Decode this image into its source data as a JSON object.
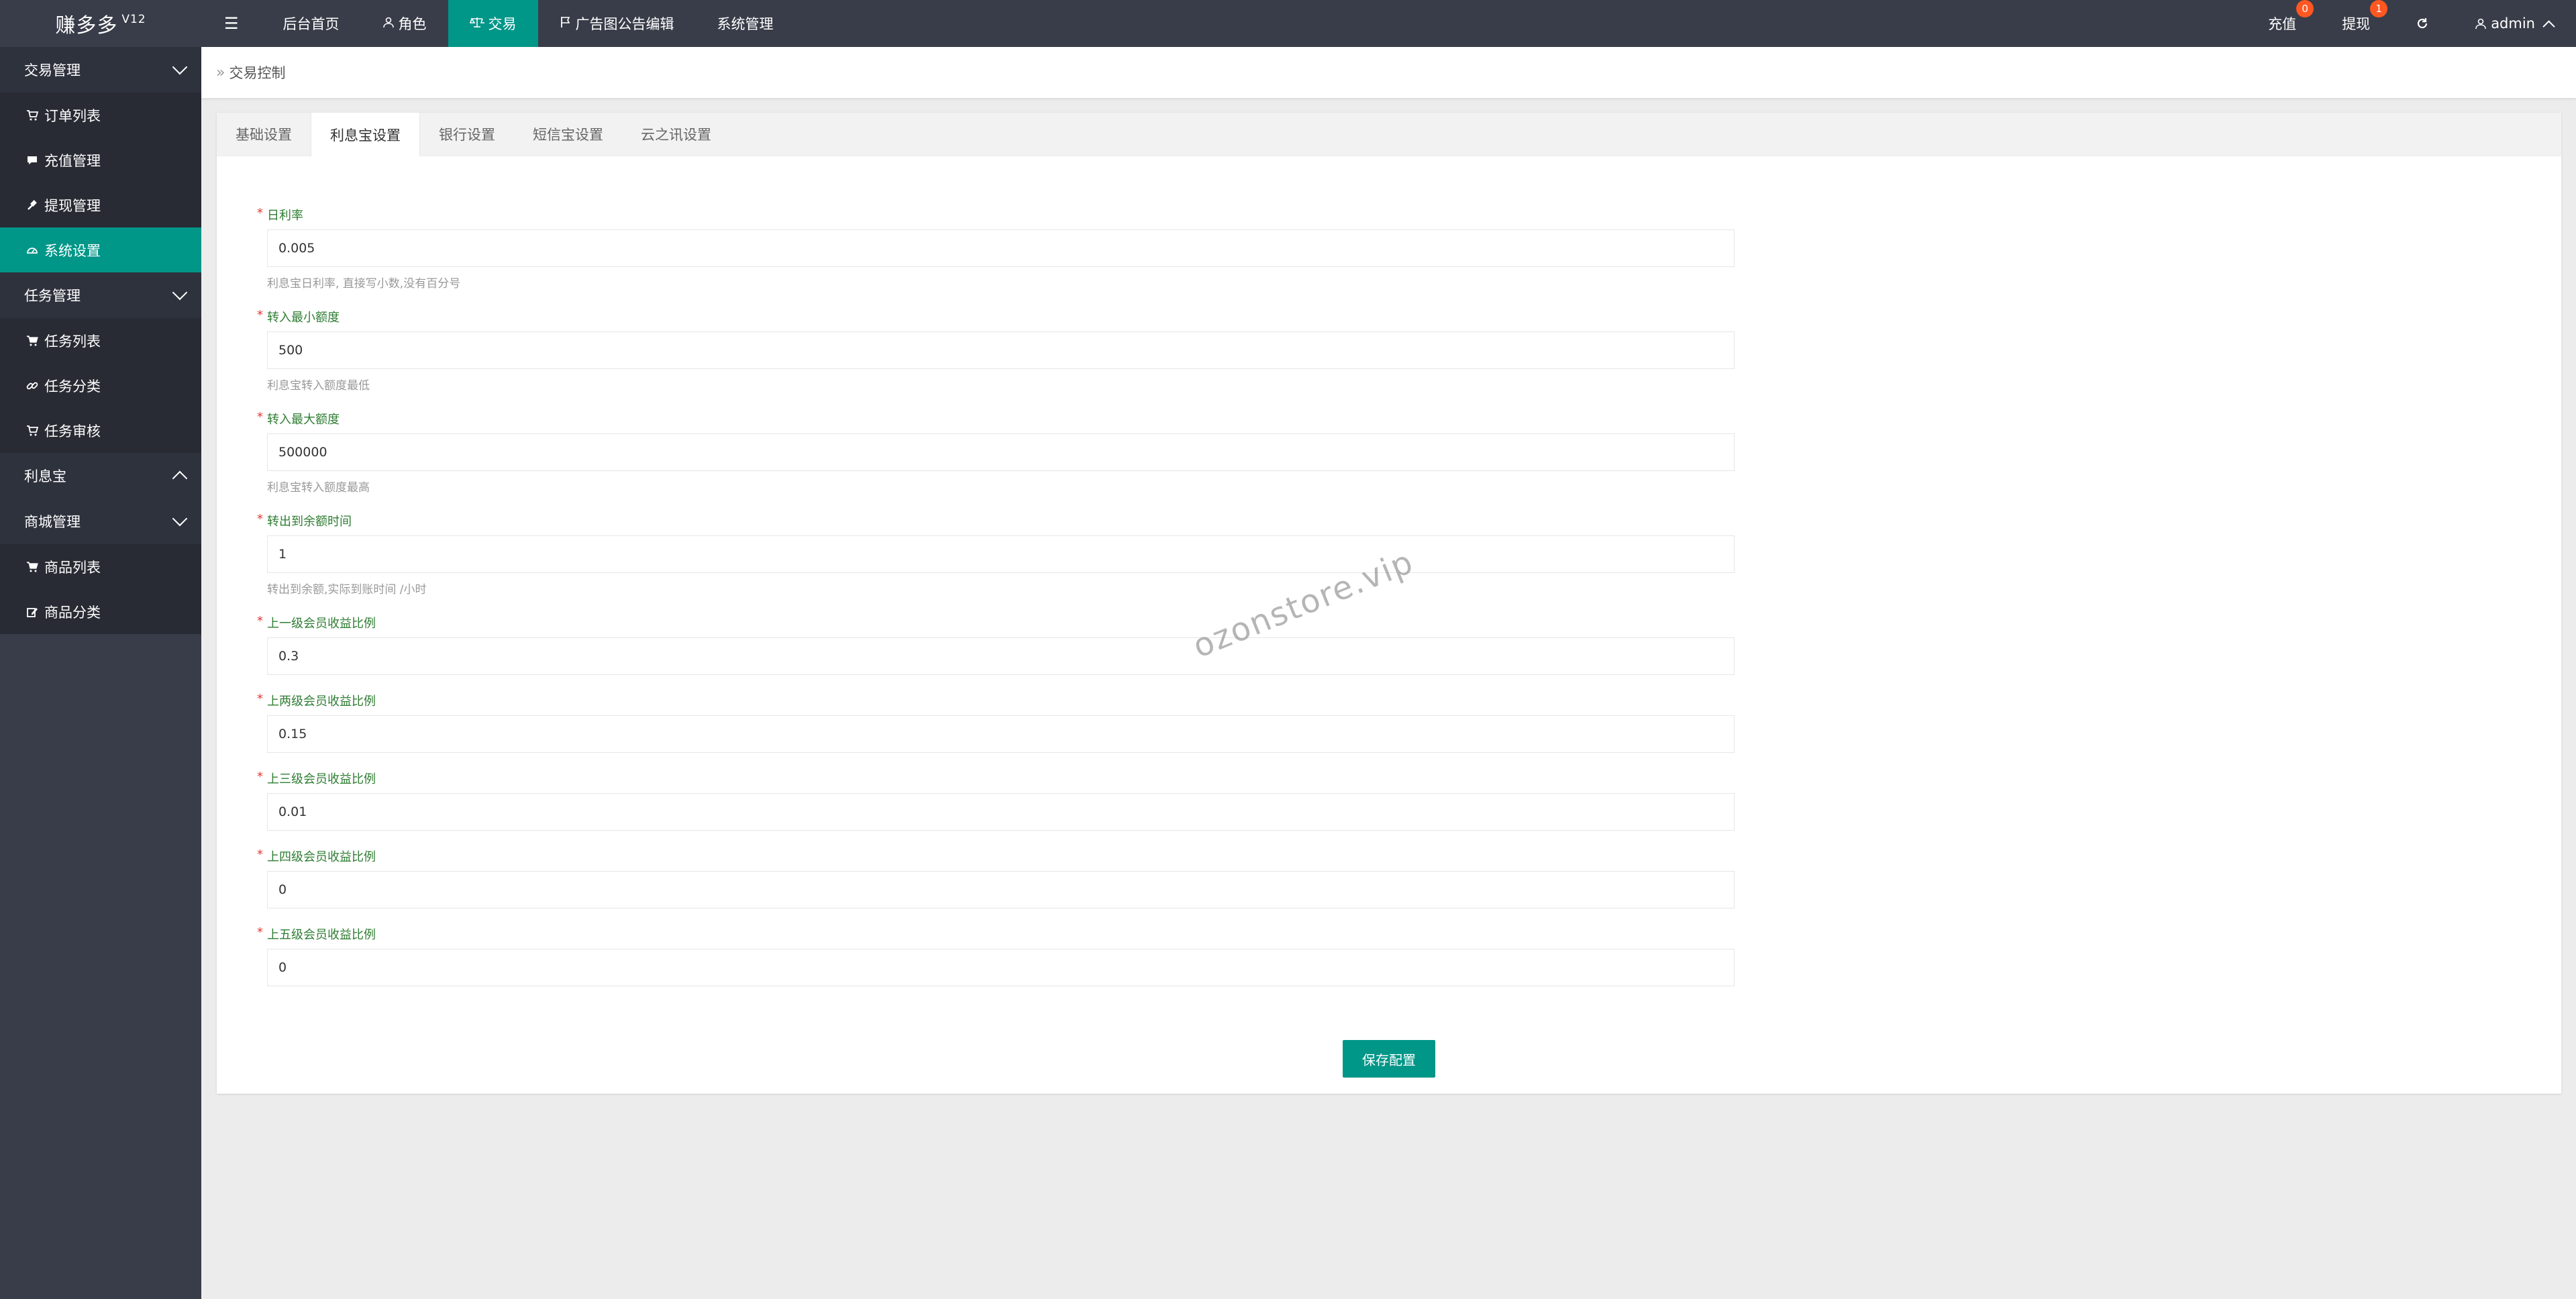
{
  "logo": {
    "name": "赚多多",
    "version": "V12"
  },
  "topnav": {
    "items": [
      {
        "label": "后台首页"
      },
      {
        "label": "角色"
      },
      {
        "label": "交易"
      },
      {
        "label": "广告图公告编辑"
      },
      {
        "label": "系统管理"
      }
    ],
    "right": {
      "recharge_label": "充值",
      "recharge_badge": "0",
      "withdraw_label": "提现",
      "withdraw_badge": "1",
      "user": "admin"
    }
  },
  "sidebar": {
    "groups": [
      {
        "label": "交易管理",
        "items": [
          {
            "label": "订单列表"
          },
          {
            "label": "充值管理"
          },
          {
            "label": "提现管理"
          },
          {
            "label": "系统设置"
          }
        ]
      },
      {
        "label": "任务管理",
        "items": [
          {
            "label": "任务列表"
          },
          {
            "label": "任务分类"
          },
          {
            "label": "任务审核"
          }
        ]
      },
      {
        "label": "利息宝"
      },
      {
        "label": "商城管理",
        "items": [
          {
            "label": "商品列表"
          },
          {
            "label": "商品分类"
          }
        ]
      }
    ]
  },
  "breadcrumb": {
    "label": "交易控制"
  },
  "tabs": [
    "基础设置",
    "利息宝设置",
    "银行设置",
    "短信宝设置",
    "云之讯设置"
  ],
  "form": {
    "fields": [
      {
        "label": "日利率",
        "value": "0.005",
        "hint": "利息宝日利率, 直接写小数,没有百分号"
      },
      {
        "label": "转入最小额度",
        "value": "500",
        "hint": "利息宝转入额度最低"
      },
      {
        "label": "转入最大额度",
        "value": "500000",
        "hint": "利息宝转入额度最高"
      },
      {
        "label": "转出到余额时间",
        "value": "1",
        "hint": "转出到余额,实际到账时间 /小时"
      },
      {
        "label": "上一级会员收益比例",
        "value": "0.3"
      },
      {
        "label": "上两级会员收益比例",
        "value": "0.15"
      },
      {
        "label": "上三级会员收益比例",
        "value": "0.01"
      },
      {
        "label": "上四级会员收益比例",
        "value": "0"
      },
      {
        "label": "上五级会员收益比例",
        "value": "0"
      }
    ],
    "save_label": "保存配置"
  },
  "watermark": "ozonstore.vip",
  "colors": {
    "accent": "#009688",
    "sidebar": "#393d49",
    "badge": "#ff5722"
  }
}
